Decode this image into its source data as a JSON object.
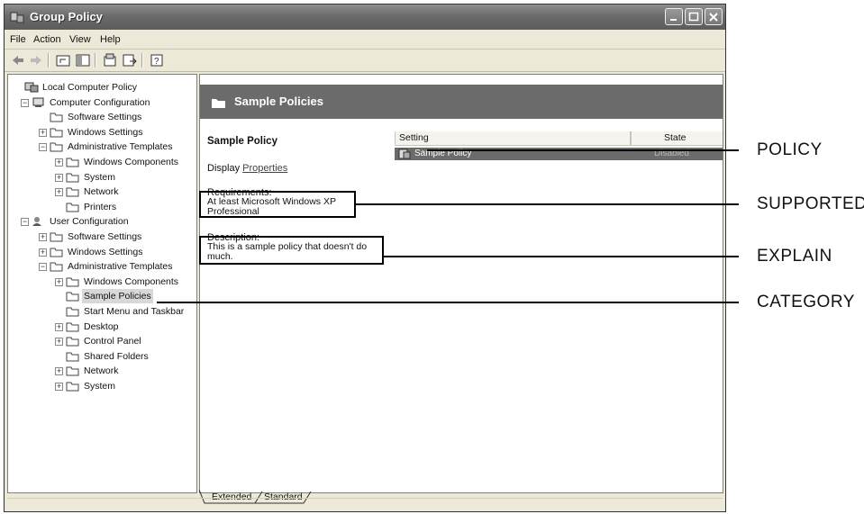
{
  "window": {
    "title": "Group Policy"
  },
  "menu": [
    "File",
    "Action",
    "View",
    "Help"
  ],
  "tree": [
    {
      "label": "Local Computer Policy",
      "depth": 0,
      "expander": ""
    },
    {
      "label": "Computer Configuration",
      "depth": 1,
      "expander": "−"
    },
    {
      "label": "Software Settings",
      "depth": 2,
      "expander": ""
    },
    {
      "label": "Windows Settings",
      "depth": 2,
      "expander": "+"
    },
    {
      "label": "Administrative Templates",
      "depth": 2,
      "expander": "−"
    },
    {
      "label": "Windows Components",
      "depth": 3,
      "expander": "+"
    },
    {
      "label": "System",
      "depth": 3,
      "expander": "+"
    },
    {
      "label": "Network",
      "depth": 3,
      "expander": "+"
    },
    {
      "label": "Printers",
      "depth": 3,
      "expander": ""
    },
    {
      "label": "User Configuration",
      "depth": 1,
      "expander": "−"
    },
    {
      "label": "Software Settings",
      "depth": 2,
      "expander": "+"
    },
    {
      "label": "Windows Settings",
      "depth": 2,
      "expander": "+"
    },
    {
      "label": "Administrative Templates",
      "depth": 2,
      "expander": "−"
    },
    {
      "label": "Windows Components",
      "depth": 3,
      "expander": "+"
    },
    {
      "label": "Sample Policies",
      "depth": 3,
      "expander": "",
      "selected": true
    },
    {
      "label": "Start Menu and Taskbar",
      "depth": 3,
      "expander": ""
    },
    {
      "label": "Desktop",
      "depth": 3,
      "expander": "+"
    },
    {
      "label": "Control Panel",
      "depth": 3,
      "expander": "+"
    },
    {
      "label": "Shared Folders",
      "depth": 3,
      "expander": ""
    },
    {
      "label": "Network",
      "depth": 3,
      "expander": "+"
    },
    {
      "label": "System",
      "depth": 3,
      "expander": "+"
    }
  ],
  "right": {
    "header_title": "Sample Policies",
    "explain": {
      "title": "Sample Policy",
      "display_prefix": "Display",
      "display_link": "Properties",
      "requirements_label": "Requirements:",
      "requirements": "At least Microsoft Windows XP Professional",
      "description_label": "Description:",
      "description": "This is a sample policy that doesn't do much."
    },
    "columns": [
      "Setting",
      "State"
    ],
    "rows": [
      {
        "setting": "Sample Policy",
        "state": "Disabled"
      }
    ]
  },
  "tabs": [
    "Extended",
    "Standard"
  ],
  "callouts": {
    "policy": "POLICY",
    "supported": "SUPPORTED",
    "explain": "EXPLAIN",
    "category": "CATEGORY"
  }
}
